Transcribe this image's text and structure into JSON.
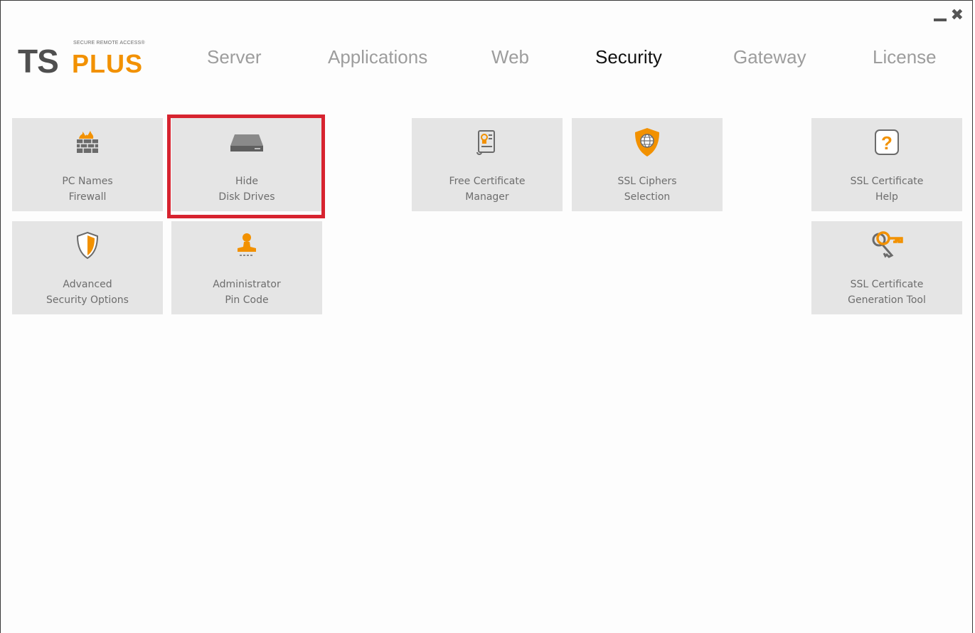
{
  "window": {
    "minimize_label": "—",
    "close_label": "✖"
  },
  "logo": {
    "ts": "TS",
    "plus": "PLUS",
    "tagline": "SECURE REMOTE ACCESS®"
  },
  "nav": {
    "tabs": [
      {
        "label": "Server",
        "active": false
      },
      {
        "label": "Applications",
        "active": false
      },
      {
        "label": "Web",
        "active": false
      },
      {
        "label": "Security",
        "active": true
      },
      {
        "label": "Gateway",
        "active": false
      },
      {
        "label": "License",
        "active": false
      }
    ]
  },
  "tiles": {
    "pc_names_firewall": {
      "line1": "PC Names",
      "line2": "Firewall",
      "icon": "firewall-icon"
    },
    "hide_disk_drives": {
      "line1": "Hide",
      "line2": "Disk Drives",
      "icon": "disk-drive-icon",
      "highlighted": true
    },
    "free_certificate_manager": {
      "line1": "Free Certificate",
      "line2": "Manager",
      "icon": "certificate-icon"
    },
    "ssl_ciphers_selection": {
      "line1": "SSL Ciphers",
      "line2": "Selection",
      "icon": "shield-globe-icon"
    },
    "ssl_certificate_help": {
      "line1": "SSL Certificate",
      "line2": "Help",
      "icon": "help-icon"
    },
    "advanced_security_options": {
      "line1": "Advanced",
      "line2": "Security Options",
      "icon": "shield-icon"
    },
    "administrator_pin_code": {
      "line1": "Administrator",
      "line2": "Pin Code",
      "icon": "user-pin-icon"
    },
    "ssl_certificate_generation_tool": {
      "line1": "SSL Certificate",
      "line2": "Generation Tool",
      "icon": "keys-icon"
    }
  },
  "colors": {
    "accent_orange": "#f29100",
    "highlight_red": "#d7232f",
    "tile_bg": "#e5e5e5",
    "inactive_tab": "#9d9d9d",
    "active_tab": "#111111"
  }
}
